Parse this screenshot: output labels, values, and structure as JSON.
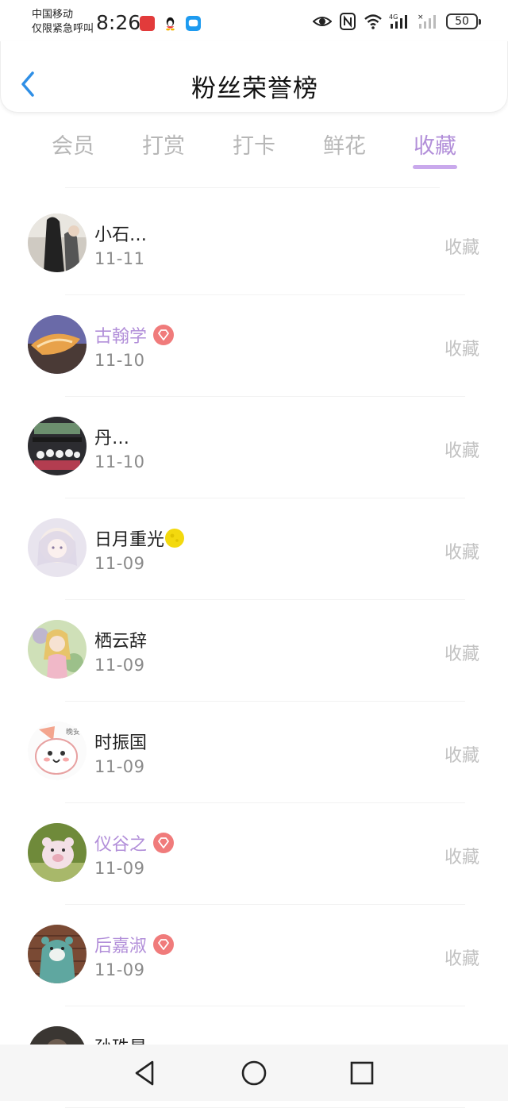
{
  "status_bar": {
    "carrier_line1": "中国移动",
    "carrier_line2": "仅限紧急呼叫",
    "time": "8:26",
    "network_type": "4G",
    "battery": "50",
    "icons": [
      "huawei-app-icon",
      "qq-icon",
      "message-icon",
      "eye-icon",
      "nfc-icon",
      "wifi-icon",
      "signal-icon",
      "no-signal-icon",
      "battery-icon"
    ]
  },
  "header": {
    "title": "粉丝荣誉榜",
    "back_icon": "chevron-left-icon"
  },
  "colors": {
    "accent": "#b28fd9",
    "indicator": "#c9a9ec",
    "back": "#2f8fe6",
    "badge": "#f07b7b",
    "muted": "#c2c2c2"
  },
  "tabs": [
    {
      "label": "会员"
    },
    {
      "label": "打赏"
    },
    {
      "label": "打卡"
    },
    {
      "label": "鲜花"
    },
    {
      "label": "收藏",
      "active": true
    }
  ],
  "list": [
    {
      "name": "小石…",
      "date": "11-11",
      "action": "收藏",
      "vip": false,
      "avatar": "photo-avatar"
    },
    {
      "name": "古翰学",
      "date": "11-10",
      "action": "收藏",
      "vip": true,
      "avatar": "shell-avatar"
    },
    {
      "name": "丹…",
      "date": "11-10",
      "action": "收藏",
      "vip": false,
      "avatar": "group-photo-avatar"
    },
    {
      "name": "日月重光",
      "date": "11-09",
      "action": "收藏",
      "vip": false,
      "emoji": "moon-emoji-icon",
      "avatar": "anime-girl-avatar"
    },
    {
      "name": "栖云辞",
      "date": "11-09",
      "action": "收藏",
      "vip": false,
      "avatar": "fairy-avatar"
    },
    {
      "name": "时振国",
      "date": "11-09",
      "action": "收藏",
      "vip": false,
      "avatar": "cartoon-avatar"
    },
    {
      "name": "仪谷之",
      "date": "11-09",
      "action": "收藏",
      "vip": true,
      "avatar": "pig-toy-avatar"
    },
    {
      "name": "后嘉淑",
      "date": "11-09",
      "action": "收藏",
      "vip": true,
      "avatar": "bear-avatar"
    },
    {
      "name": "孙珠是",
      "date": "",
      "action": "",
      "vip": false,
      "avatar": "partial-avatar"
    }
  ],
  "nav_bar": {
    "buttons": [
      "back-triangle-icon",
      "home-circle-icon",
      "recents-square-icon"
    ]
  }
}
